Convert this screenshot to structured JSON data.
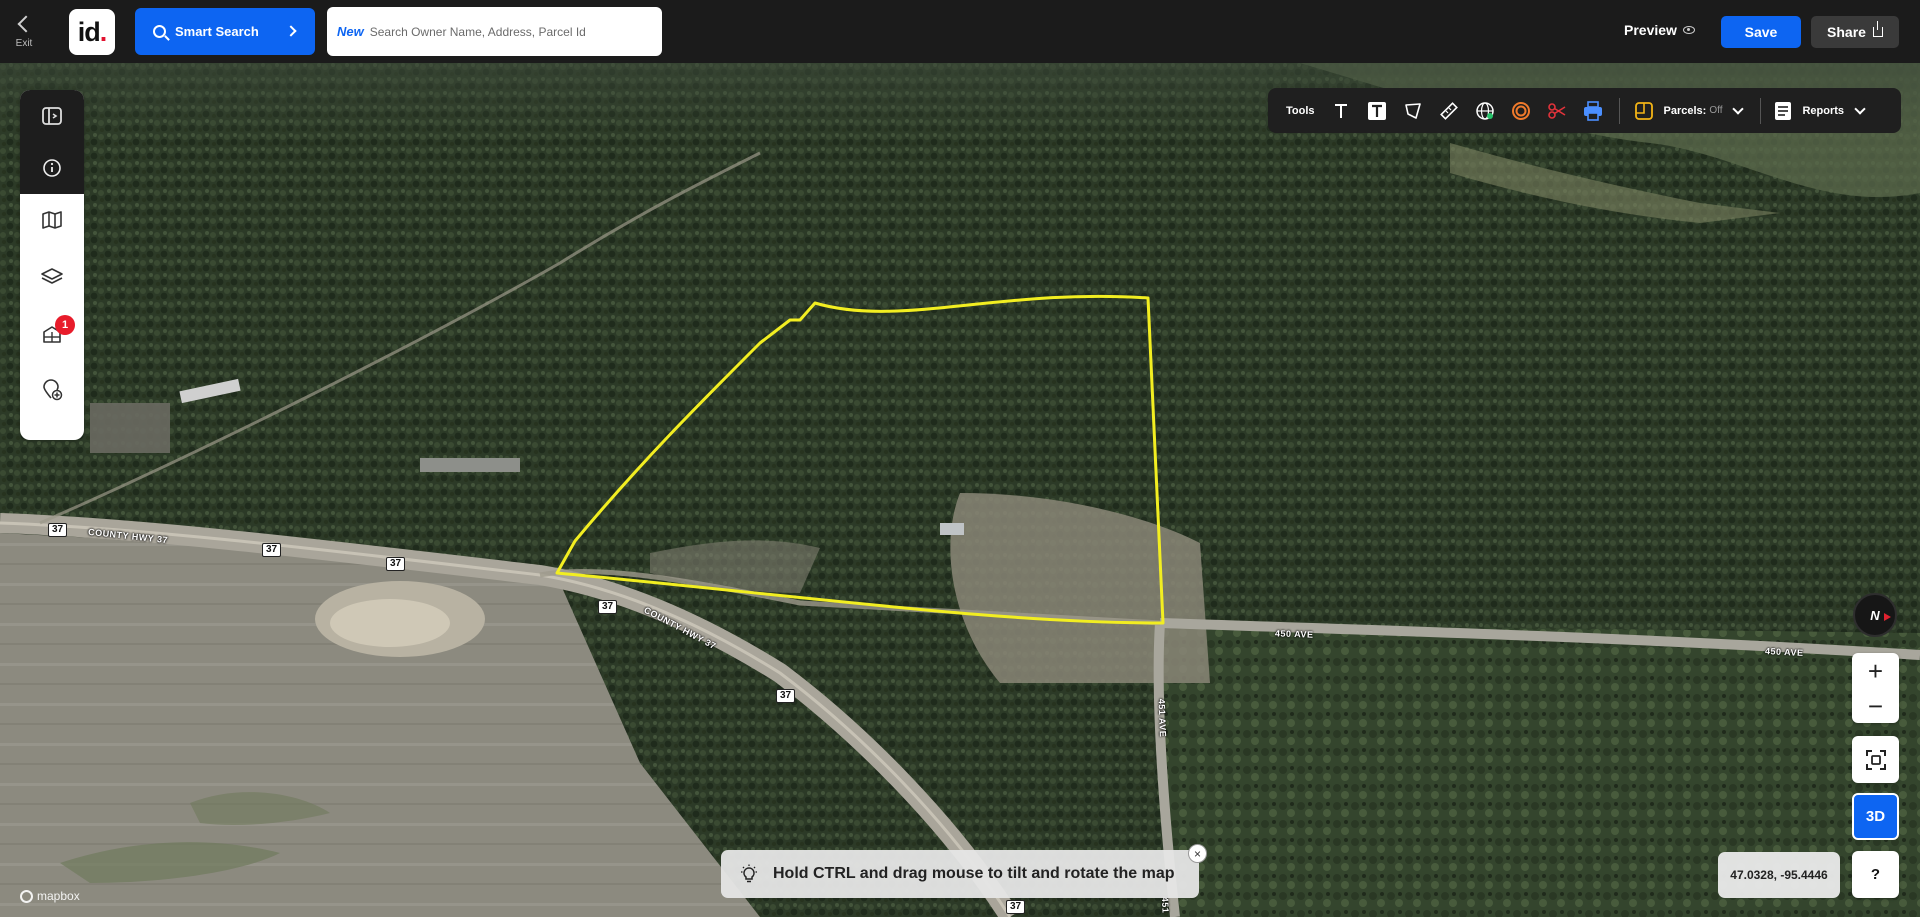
{
  "topbar": {
    "exit_label": "Exit",
    "logo_text": "id",
    "logo_dot": ".",
    "smart_search_label": "Smart Search",
    "search_new_tag": "New",
    "search_placeholder": "Search Owner Name, Address, Parcel Id",
    "preview_label": "Preview",
    "save_label": "Save",
    "share_label": "Share"
  },
  "sidebar": {
    "items": [
      {
        "icon": "panel-toggle-icon"
      },
      {
        "icon": "info-icon"
      },
      {
        "icon": "map-icon"
      },
      {
        "icon": "layers-icon"
      },
      {
        "icon": "parcel-grid-icon",
        "badge": "1"
      },
      {
        "icon": "add-location-icon"
      }
    ]
  },
  "tools": {
    "label": "Tools",
    "items": [
      "text-icon",
      "text-box-icon",
      "polygon-icon",
      "ruler-icon",
      "globe-icon",
      "buffer-ring-icon",
      "scissors-icon",
      "printer-icon"
    ],
    "parcels_label": "Parcels:",
    "parcels_value": "Off",
    "reports_label": "Reports"
  },
  "map": {
    "roads": {
      "shields": [
        "37",
        "37",
        "37",
        "37",
        "37",
        "37"
      ],
      "labels": [
        "COUNTY HWY 37",
        "COUNTY HWY 37",
        "450 AVE",
        "450 AVE",
        "451 AVE",
        "451"
      ]
    },
    "colors": {
      "parcel_outline": "#f2ee21",
      "accent": "#0d65f2"
    }
  },
  "controls": {
    "compass_label": "N",
    "zoom_in": "+",
    "zoom_out": "−",
    "btn_3d": "3D",
    "help": "?",
    "coordinates": "47.0328, -95.4446"
  },
  "hint": {
    "text": "Hold CTRL and drag mouse to tilt and rotate the map",
    "close": "×"
  },
  "attribution": "mapbox"
}
